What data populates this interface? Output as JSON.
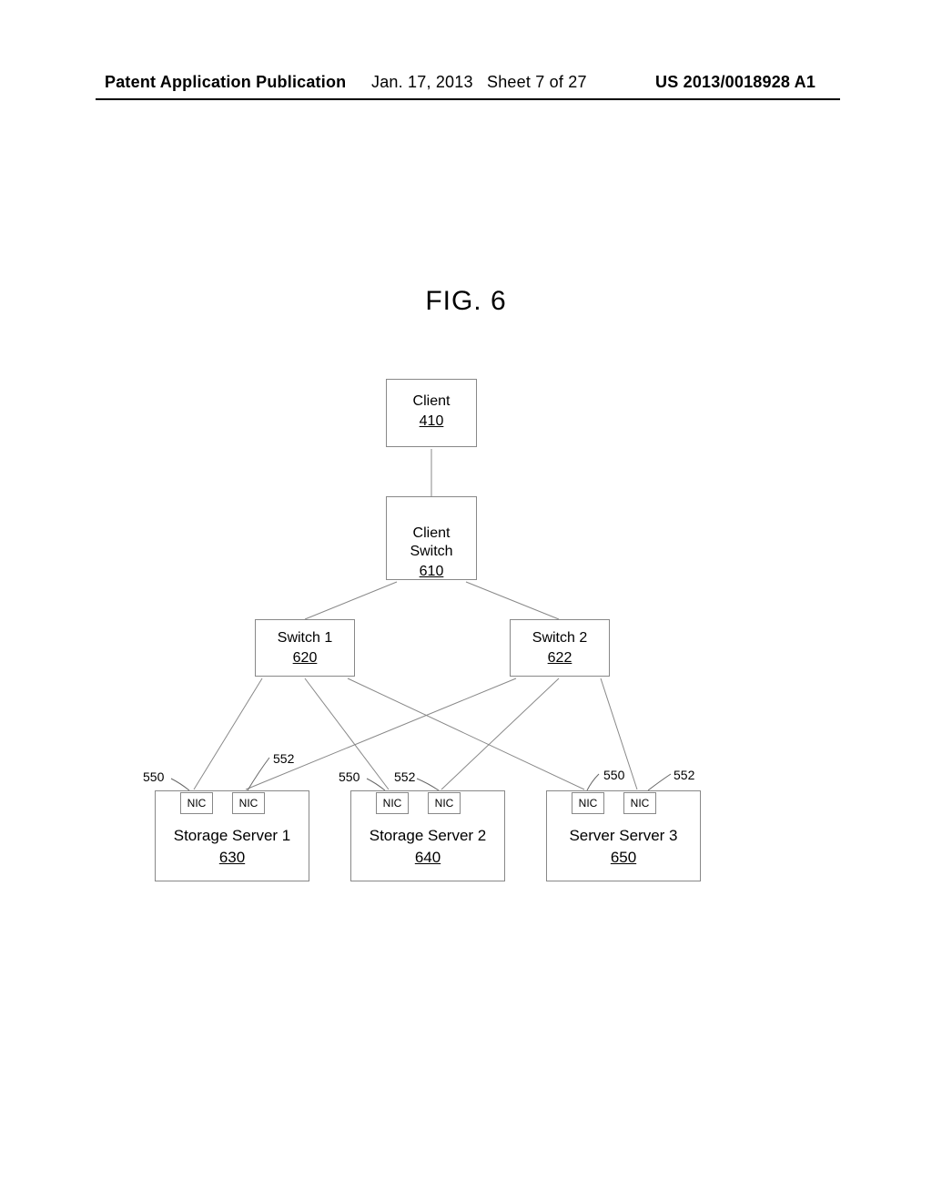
{
  "header": {
    "publication": "Patent Application Publication",
    "date": "Jan. 17, 2013",
    "sheet": "Sheet 7 of 27",
    "pubnum": "US 2013/0018928 A1"
  },
  "figure": {
    "title": "FIG. 6"
  },
  "nodes": {
    "client": {
      "label": "Client",
      "ref": "410"
    },
    "client_switch": {
      "label": "Client\nSwitch",
      "ref": "610"
    },
    "switch1": {
      "label": "Switch 1",
      "ref": "620"
    },
    "switch2": {
      "label": "Switch 2",
      "ref": "622"
    },
    "server1": {
      "label": "Storage Server 1",
      "ref": "630"
    },
    "server2": {
      "label": "Storage Server 2",
      "ref": "640"
    },
    "server3": {
      "label": "Server Server 3",
      "ref": "650"
    },
    "nic": "NIC"
  },
  "callouts": {
    "p550": "550",
    "p552": "552"
  }
}
